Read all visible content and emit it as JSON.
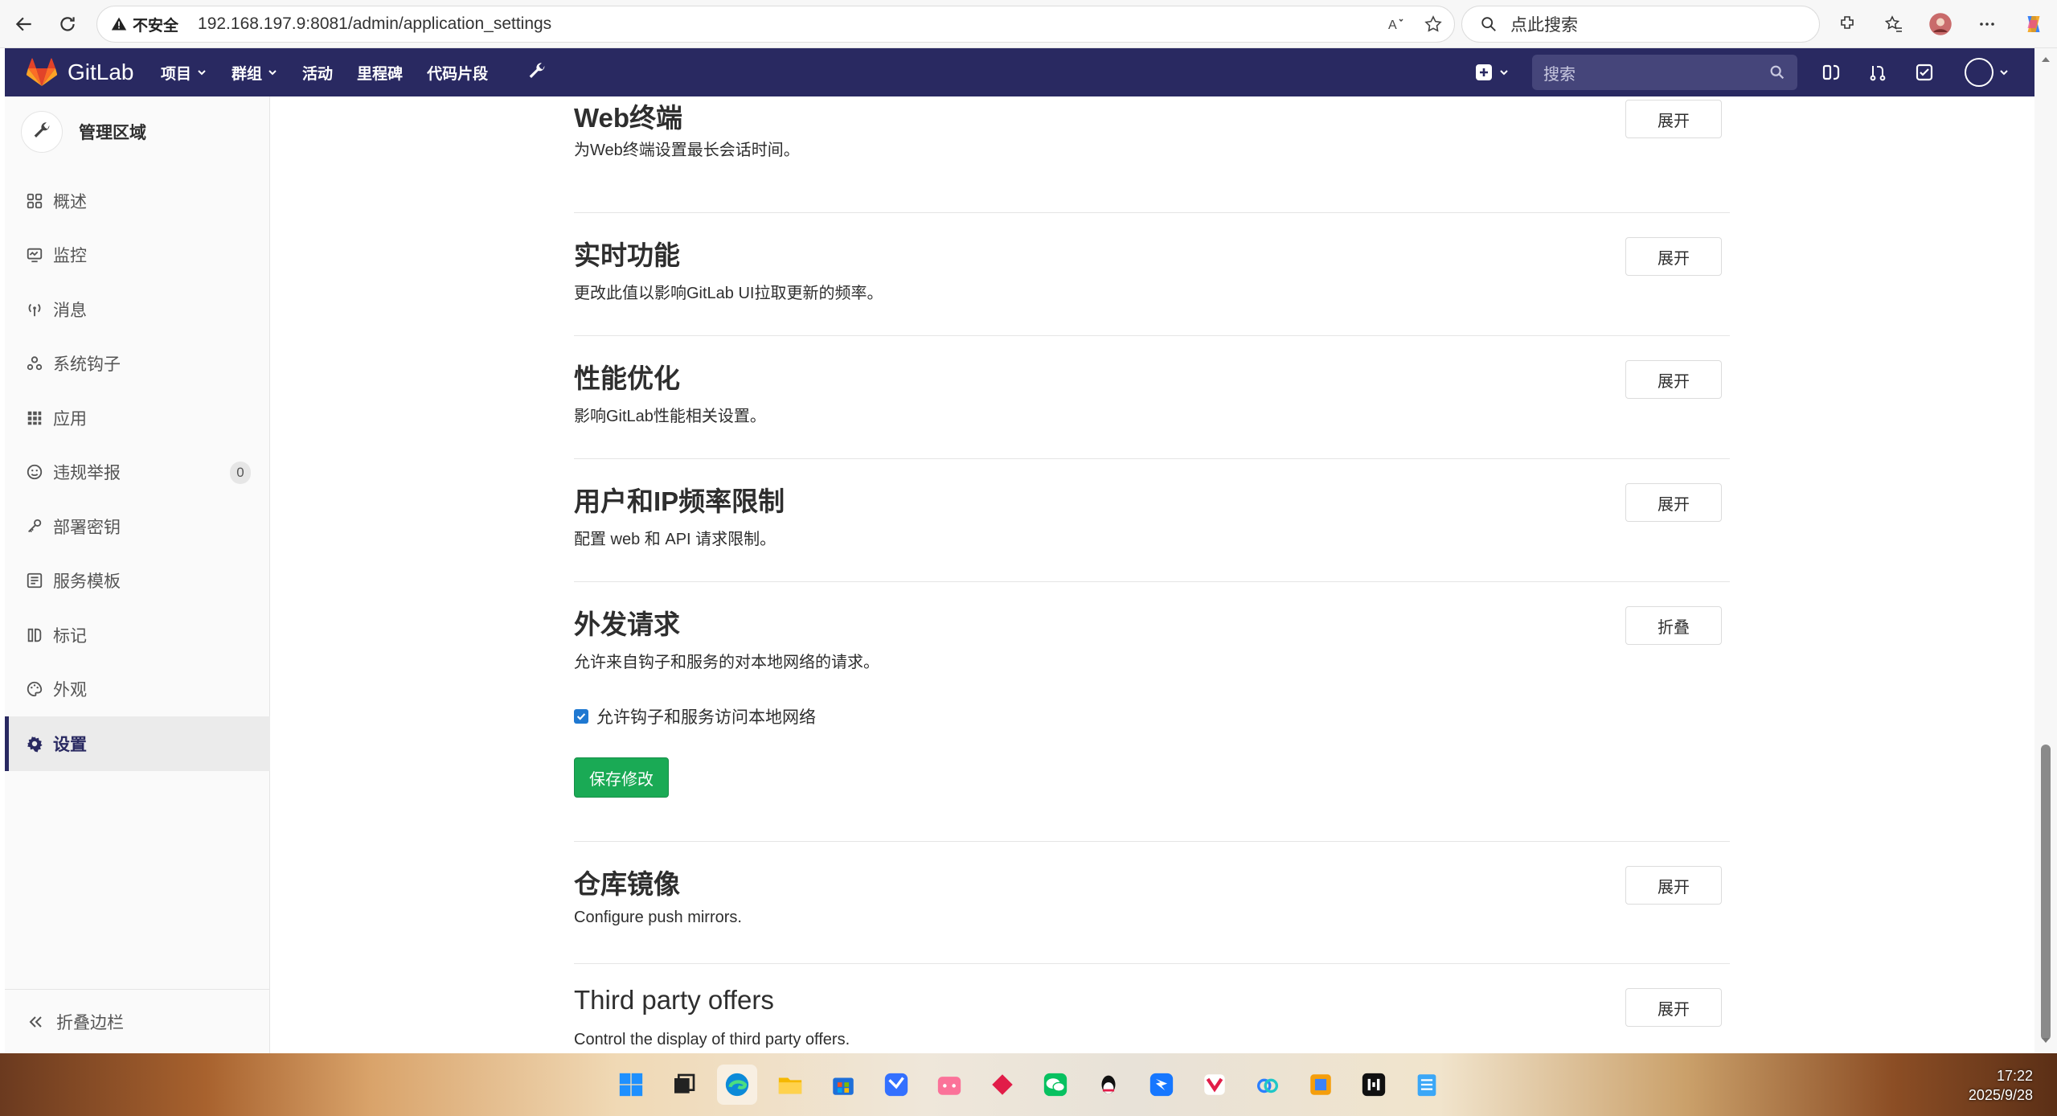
{
  "browser": {
    "security_label": "不安全",
    "url": "192.168.197.9:8081/admin/application_settings",
    "search_placeholder": "点此搜索"
  },
  "header": {
    "brand": "GitLab",
    "nav": [
      "项目",
      "群组",
      "活动",
      "里程碑",
      "代码片段"
    ],
    "search_placeholder": "搜索"
  },
  "sidebar": {
    "title": "管理区域",
    "items": [
      {
        "label": "概述",
        "icon": "overview-grid-icon"
      },
      {
        "label": "监控",
        "icon": "monitor-icon"
      },
      {
        "label": "消息",
        "icon": "broadcast-icon"
      },
      {
        "label": "系统钩子",
        "icon": "hook-icon"
      },
      {
        "label": "应用",
        "icon": "apps-grid-icon"
      },
      {
        "label": "违规举报",
        "icon": "smiley-icon",
        "badge": "0"
      },
      {
        "label": "部署密钥",
        "icon": "key-icon"
      },
      {
        "label": "服务模板",
        "icon": "template-icon"
      },
      {
        "label": "标记",
        "icon": "labels-icon"
      },
      {
        "label": "外观",
        "icon": "palette-icon"
      },
      {
        "label": "设置",
        "icon": "gear-icon",
        "active": true
      }
    ],
    "collapse_label": "折叠边栏"
  },
  "sections": [
    {
      "title": "Web终端",
      "description": "为Web终端设置最长会话时间。",
      "button": "展开"
    },
    {
      "title": "实时功能",
      "description": "更改此值以影响GitLab UI拉取更新的频率。",
      "button": "展开"
    },
    {
      "title": "性能优化",
      "description": "影响GitLab性能相关设置。",
      "button": "展开"
    },
    {
      "title": "用户和IP频率限制",
      "description": "配置 web 和 API 请求限制。",
      "button": "展开"
    },
    {
      "title": "外发请求",
      "description": "允许来自钩子和服务的对本地网络的请求。",
      "button": "折叠",
      "checkbox_label": "允许钩子和服务访问本地网络",
      "checkbox_checked": true,
      "save_label": "保存修改"
    },
    {
      "title": "仓库镜像",
      "description": "Configure push mirrors.",
      "button": "展开"
    },
    {
      "title": "Third party offers",
      "description": "Control the display of third party offers.",
      "button": "展开"
    }
  ],
  "taskbar": {
    "time": "17:22",
    "date": "2025/9/28"
  },
  "colors": {
    "header_bg": "#292961",
    "save_button": "#1aaa55",
    "checkbox": "#1f78d1"
  }
}
